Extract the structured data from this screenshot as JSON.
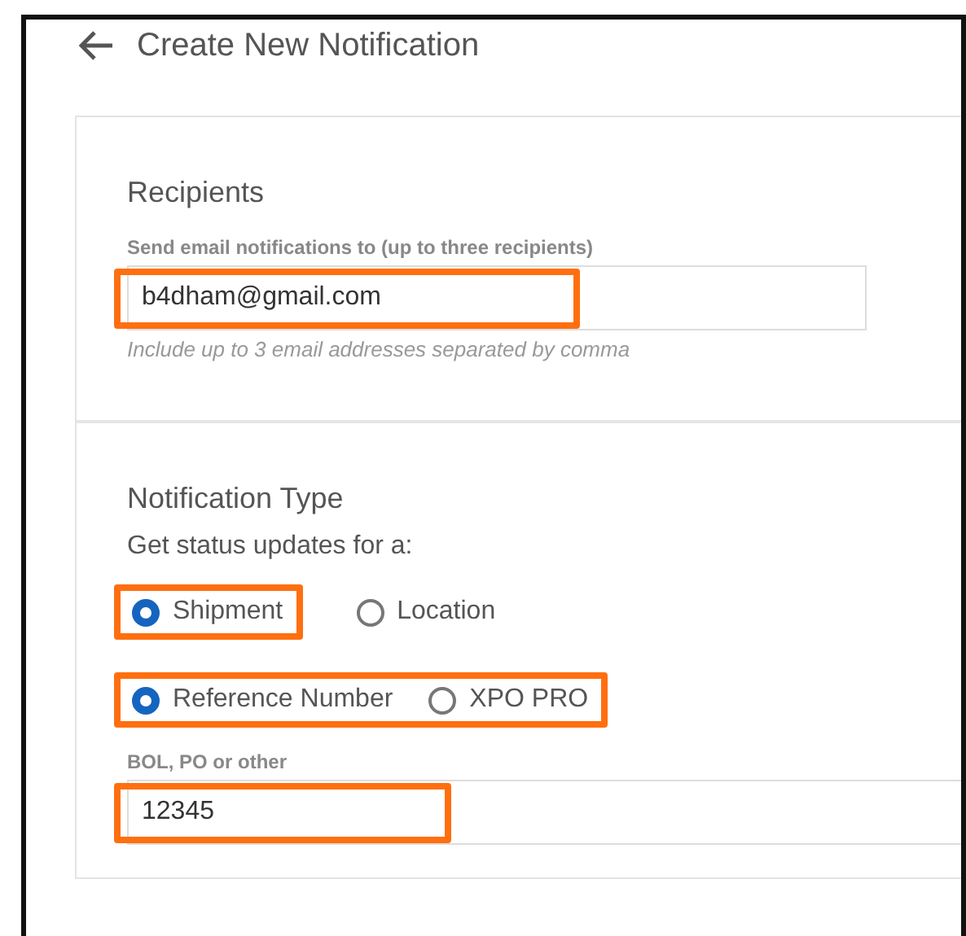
{
  "header": {
    "title": "Create New Notification"
  },
  "recipients": {
    "title": "Recipients",
    "label": "Send email notifications to (up to three recipients)",
    "value": "b4dham@gmail.com",
    "highlighted": true,
    "hint": "Include up to 3 email addresses separated by comma"
  },
  "notification_type": {
    "title": "Notification Type",
    "subtitle": "Get status updates for a:",
    "radio_groups": [
      {
        "options": [
          {
            "label": "Shipment",
            "selected": true,
            "highlighted": true
          },
          {
            "label": "Location",
            "selected": false,
            "highlighted": false
          }
        ]
      },
      {
        "options": [
          {
            "label": "Reference Number",
            "selected": true,
            "highlighted": true
          },
          {
            "label": "XPO PRO",
            "selected": false,
            "highlighted": true
          }
        ]
      }
    ],
    "reference": {
      "label": "BOL, PO or other",
      "value": "12345",
      "highlighted": true
    }
  }
}
